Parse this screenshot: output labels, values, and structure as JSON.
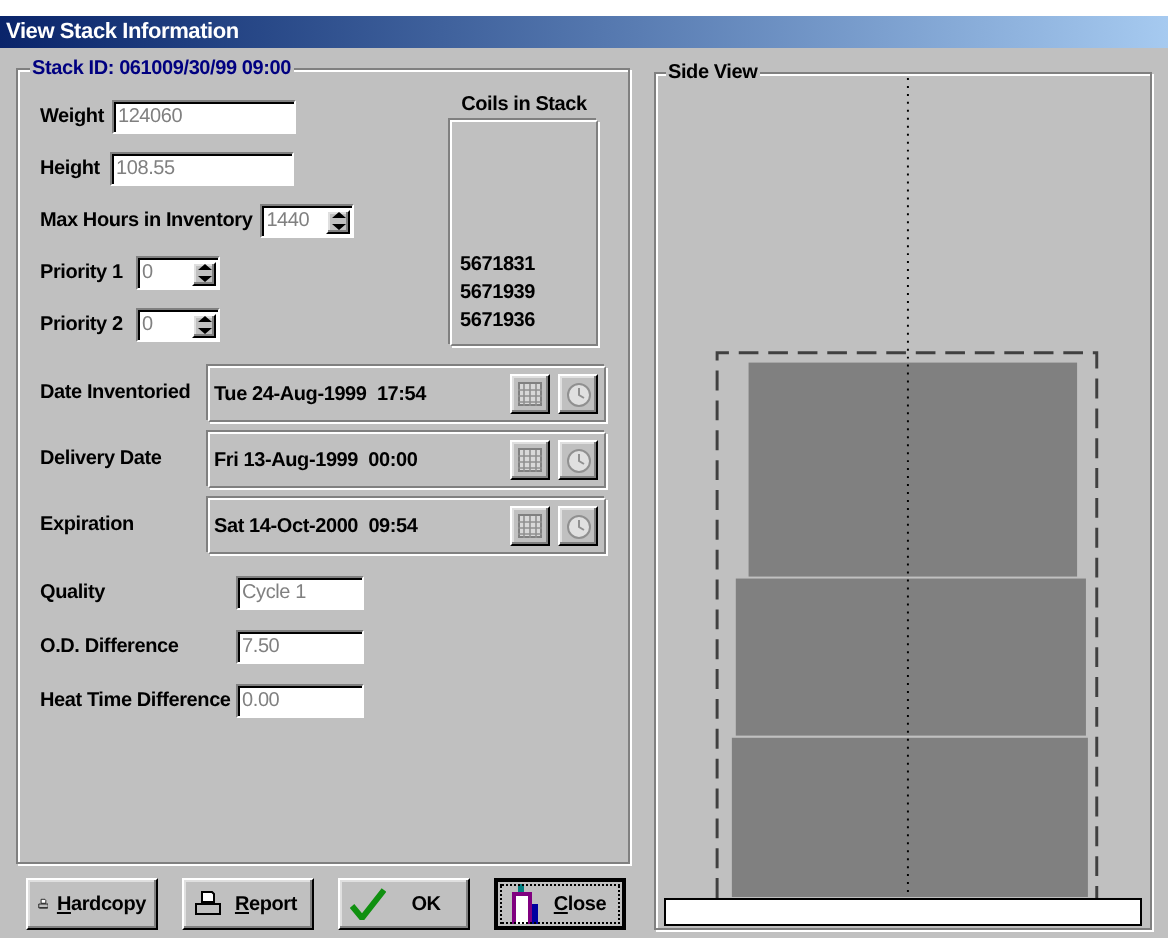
{
  "window": {
    "title": "View Stack Information"
  },
  "stack": {
    "title": "Stack ID: 061009/30/99 09:00",
    "fields": [
      {
        "label": "Weight",
        "value": "124060",
        "kind": "text",
        "disabled": true
      },
      {
        "label": "Height",
        "value": "108.55",
        "kind": "text",
        "disabled": true
      },
      {
        "label": "Max Hours in Inventory",
        "value": "1440",
        "kind": "spin",
        "disabled": true
      },
      {
        "label": "Priority 1",
        "value": "0",
        "kind": "spin",
        "disabled": true
      },
      {
        "label": "Priority 2",
        "value": "0",
        "kind": "spin",
        "disabled": true
      }
    ],
    "coils": {
      "title": "Coils in Stack",
      "items": [
        "5671831",
        "5671939",
        "5671936"
      ]
    },
    "dates": [
      {
        "label": "Date Inventoried",
        "value": "Tue 24-Aug-1999  17:54"
      },
      {
        "label": "Delivery Date",
        "value": "Fri 13-Aug-1999  00:00"
      },
      {
        "label": "Expiration",
        "value": "Sat 14-Oct-2000  09:54"
      }
    ],
    "details": [
      {
        "label": "Quality",
        "value": "Cycle 1",
        "disabled": true
      },
      {
        "label": "O.D. Difference",
        "value": "7.50",
        "disabled": true
      },
      {
        "label": "Heat Time Difference",
        "value": "0.00",
        "disabled": true
      }
    ]
  },
  "side_view": {
    "title": "Side View"
  },
  "buttons": [
    {
      "label": "Hardcopy",
      "kind": "printer",
      "access_key": true,
      "focused": false
    },
    {
      "label": "Report",
      "kind": "printer",
      "access_key": true,
      "focused": false
    },
    {
      "label": "OK",
      "kind": "check",
      "access_key": false,
      "focused": false
    },
    {
      "label": "Close",
      "kind": "exit",
      "access_key": true,
      "focused": true
    }
  ]
}
